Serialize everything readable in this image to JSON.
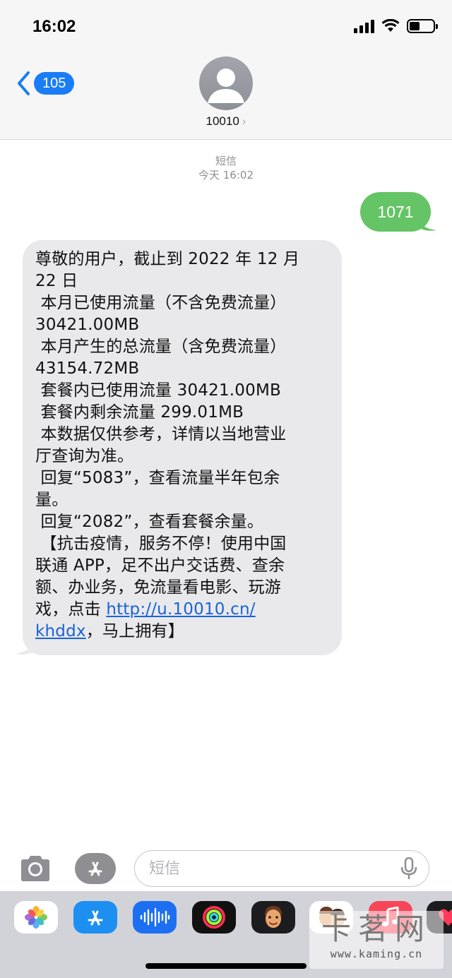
{
  "status_bar": {
    "time": "16:02"
  },
  "nav": {
    "back_count": "105",
    "contact_name": "10010",
    "contact_chevron": "›"
  },
  "conversation": {
    "label": "短信",
    "timestamp": "今天 16:02",
    "outgoing": {
      "text": "1071"
    },
    "incoming": {
      "lines": [
        "尊敬的用户，截止到 2022 年 12 月",
        "22 日",
        " 本月已使用流量（不含免费流量）",
        "30421.00MB",
        " 本月产生的总流量（含免费流量）",
        "43154.72MB",
        " 套餐内已使用流量 30421.00MB",
        " 套餐内剩余流量 299.01MB",
        " 本数据仅供参考，详情以当地营业",
        "厅查询为准。",
        " 回复“5083”，查看流量半年包余",
        "量。",
        " 回复“2082”，查看套餐余量。",
        " 【抗击疫情，服务不停！使用中国",
        "联通 APP，足不出户交话费、查余",
        "额、办业务，免流量看电影、玩游"
      ],
      "line_16_prefix": "戏，点击 ",
      "link_part1": "http://u.10010.cn/",
      "link_part2": "khddx",
      "suffix": "，马上拥有】"
    }
  },
  "input": {
    "placeholder": "短信"
  },
  "app_drawer": {
    "apps": [
      {
        "name": "photos-app-icon",
        "bg": "#ffffff"
      },
      {
        "name": "app-store-app-icon",
        "bg": "#1d8ff1"
      },
      {
        "name": "audio-message-app-icon",
        "bg": "#1d6ff1"
      },
      {
        "name": "activity-app-icon",
        "bg": "#111111"
      },
      {
        "name": "memoji-app-icon",
        "bg": "#1c1c1e"
      },
      {
        "name": "memoji-stickers-app-icon",
        "bg": "#ffffff"
      },
      {
        "name": "music-app-icon",
        "bg": "#f84659"
      },
      {
        "name": "fitness-app-icon",
        "bg": "#1c1c1e"
      }
    ]
  },
  "watermark": {
    "big": "卡茗网",
    "small": "www.kaming.cn"
  },
  "colors": {
    "imessage_blue": "#1a7df5",
    "sms_green": "#65c466",
    "incoming_gray": "#e9e9eb"
  }
}
